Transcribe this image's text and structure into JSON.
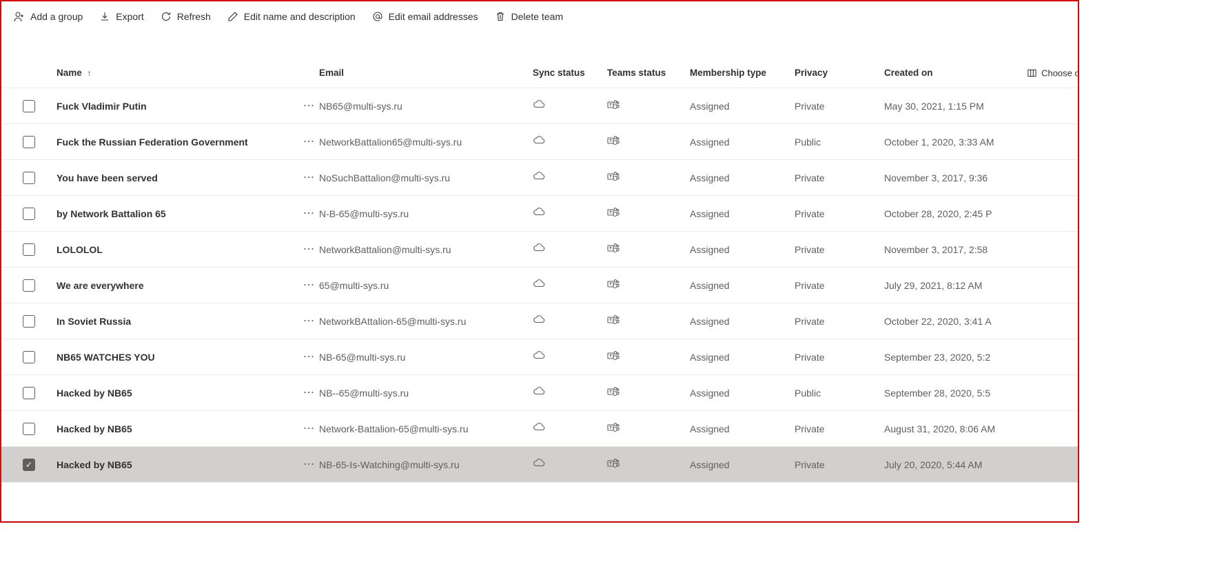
{
  "toolbar": {
    "add_group": "Add a group",
    "export": "Export",
    "refresh": "Refresh",
    "edit_name": "Edit name and description",
    "edit_email": "Edit email addresses",
    "delete_team": "Delete team"
  },
  "columns": {
    "name": "Name",
    "email": "Email",
    "sync": "Sync status",
    "teams": "Teams status",
    "membership": "Membership type",
    "privacy": "Privacy",
    "created": "Created on",
    "choose": "Choose c"
  },
  "rows": [
    {
      "name": "Fuck Vladimir Putin",
      "email": "NB65@multi-sys.ru",
      "membership": "Assigned",
      "privacy": "Private",
      "created": "May 30, 2021, 1:15 PM",
      "selected": false
    },
    {
      "name": "Fuck the Russian Federation Government",
      "email": "NetworkBattalion65@multi-sys.ru",
      "membership": "Assigned",
      "privacy": "Public",
      "created": "October 1, 2020, 3:33 AM",
      "selected": false
    },
    {
      "name": "You have been served",
      "email": "NoSuchBattalion@multi-sys.ru",
      "membership": "Assigned",
      "privacy": "Private",
      "created": "November 3, 2017, 9:36",
      "selected": false
    },
    {
      "name": "by Network Battalion 65",
      "email": "N-B-65@multi-sys.ru",
      "membership": "Assigned",
      "privacy": "Private",
      "created": "October 28, 2020, 2:45 P",
      "selected": false
    },
    {
      "name": "LOLOLOL",
      "email": "NetworkBattalion@multi-sys.ru",
      "membership": "Assigned",
      "privacy": "Private",
      "created": "November 3, 2017, 2:58",
      "selected": false
    },
    {
      "name": "We are everywhere",
      "email": "65@multi-sys.ru",
      "membership": "Assigned",
      "privacy": "Private",
      "created": "July 29, 2021, 8:12 AM",
      "selected": false
    },
    {
      "name": "In Soviet Russia",
      "email": "NetworkBAttalion-65@multi-sys.ru",
      "membership": "Assigned",
      "privacy": "Private",
      "created": "October 22, 2020, 3:41 A",
      "selected": false
    },
    {
      "name": "NB65 WATCHES YOU",
      "email": "NB-65@multi-sys.ru",
      "membership": "Assigned",
      "privacy": "Private",
      "created": "September 23, 2020, 5:2",
      "selected": false
    },
    {
      "name": "Hacked by NB65",
      "email": "NB--65@multi-sys.ru",
      "membership": "Assigned",
      "privacy": "Public",
      "created": "September 28, 2020, 5:5",
      "selected": false
    },
    {
      "name": "Hacked by NB65",
      "email": "Network-Battalion-65@multi-sys.ru",
      "membership": "Assigned",
      "privacy": "Private",
      "created": "August 31, 2020, 8:06 AM",
      "selected": false
    },
    {
      "name": "Hacked by NB65",
      "email": "NB-65-Is-Watching@multi-sys.ru",
      "membership": "Assigned",
      "privacy": "Private",
      "created": "July 20, 2020, 5:44 AM",
      "selected": true
    }
  ]
}
